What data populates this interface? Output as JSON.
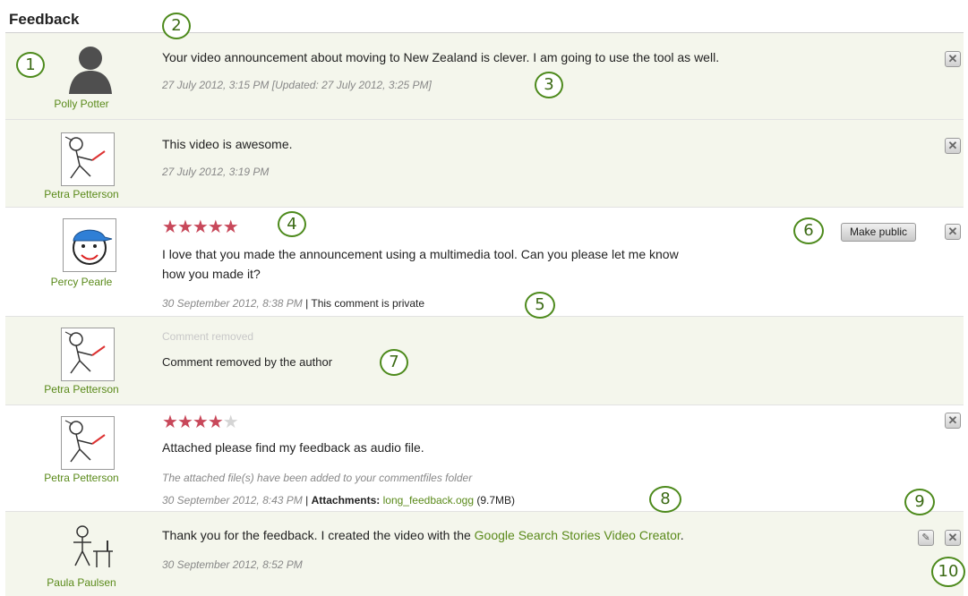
{
  "section_title": "Feedback",
  "comments": [
    {
      "author": "Polly Potter",
      "text": "Your video announcement about moving to New Zealand is clever. I am going to use the tool as well.",
      "date": "27 July 2012, 3:15 PM [Updated: 27 July 2012, 3:25 PM]",
      "avatar_icon": "silhouette-avatar"
    },
    {
      "author": "Petra Petterson",
      "text": "This video is awesome.",
      "date": "27 July 2012, 3:19 PM",
      "avatar_icon": "stick-figure-avatar"
    },
    {
      "author": "Percy Pearle",
      "rating": 5,
      "rating_max": 5,
      "text_line1": "I love that you made the announcement using a multimedia tool. Can you please let me know",
      "text_line2": "how you made it?",
      "date": "30 September 2012, 8:38 PM",
      "separator": " | ",
      "privacy": "This comment is private",
      "make_public_label": "Make public",
      "avatar_icon": "smiley-cap-avatar"
    },
    {
      "author": "Petra Petterson",
      "removed_title": "Comment removed",
      "text": "Comment removed by the author",
      "avatar_icon": "stick-figure-avatar"
    },
    {
      "author": "Petra Petterson",
      "rating": 4,
      "rating_max": 5,
      "text": "Attached please find my feedback as audio file.",
      "notice": "The attached file(s) have been added to your commentfiles folder",
      "date": "30 September 2012, 8:43 PM",
      "separator": " | ",
      "attachments_label": "Attachments:",
      "attachment_name": "long_feedback.ogg",
      "attachment_size": "(9.7MB)",
      "avatar_icon": "stick-figure-avatar"
    },
    {
      "author": "Paula Paulsen",
      "text_before": "Thank you for the feedback. I created the video with the ",
      "link_text": "Google Search Stories Video Creator",
      "text_after": ".",
      "date": "30 September 2012, 8:52 PM",
      "avatar_icon": "stick-figure-desk-avatar"
    }
  ],
  "delete_icon_glyph": "✕",
  "edit_icon_glyph": "✎",
  "callouts": [
    "1",
    "2",
    "3",
    "4",
    "5",
    "6",
    "7",
    "8",
    "9",
    "10"
  ],
  "colors": {
    "accent_green": "#5a8a1a",
    "row_shade": "#f4f6ec",
    "star_on": "#c8485a",
    "star_off": "#d5d5d5",
    "callout_border": "#4d8a1c"
  }
}
